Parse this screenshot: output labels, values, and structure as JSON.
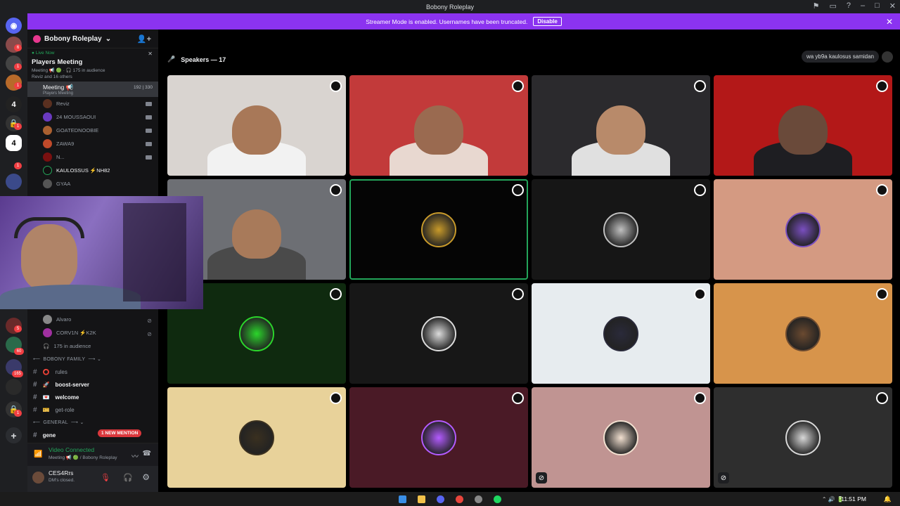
{
  "window": {
    "title": "Bobony Roleplay"
  },
  "banner": {
    "text": "Streamer Mode is enabled. Usernames have been truncated.",
    "button": "Disable"
  },
  "server": {
    "name": "Bobony Roleplay"
  },
  "event": {
    "live": "Live Now",
    "title": "Players Meeting",
    "meta": "Meeting 📢 🟢 · 🎧 175 in audience",
    "people": "Reviz and 16 others"
  },
  "stage_channel": {
    "name": "Meeting",
    "emoji": "📢",
    "sub": "Players Meeting",
    "count_a": "192",
    "count_b": "330"
  },
  "voice_users": [
    "Reviz",
    "24 MOUSSAOUI",
    "GOATEDNOOBIE",
    "ZAWA9",
    "N...",
    "KAULOSSUS ⚡NH82",
    "GYAA"
  ],
  "lower_users": [
    "Alvaro",
    "CORV1N ⚡K2K"
  ],
  "audience": "175 in audience",
  "categories": [
    "BOBONY FAMILY",
    "GENERAL"
  ],
  "text_channels": [
    {
      "name": "rules",
      "bold": false
    },
    {
      "name": "boost-server",
      "bold": true
    },
    {
      "name": "welcome",
      "bold": true
    },
    {
      "name": "get-role",
      "bold": false
    }
  ],
  "general_partial": "gene",
  "mention_pill": "1 NEW MENTION",
  "voice_connected": {
    "status": "Video Connected",
    "detail": "Meeting 📢 🟢 / Bobony Roleplay"
  },
  "user": {
    "name": "CES4Rrs",
    "status": "DM's closed."
  },
  "stage": {
    "header": "Speakers — 17",
    "topic_pill": "wa yb9a kaulosus samidan"
  },
  "rail_badges": [
    "6",
    "1",
    "1",
    "1",
    "1",
    "5",
    "60",
    "165",
    "1"
  ],
  "tiles": [
    {
      "type": "cam",
      "bg": "#d9d4d0"
    },
    {
      "type": "cam",
      "bg": "#c23a3a"
    },
    {
      "type": "cam",
      "bg": "#2b2a2d"
    },
    {
      "type": "cam",
      "bg": "#b31818"
    },
    {
      "type": "cam",
      "bg": "#6d6f74"
    },
    {
      "type": "avatar",
      "bg": "#050505",
      "ring": "#c89a2a",
      "speaking": true
    },
    {
      "type": "avatar",
      "bg": "#161616",
      "ring": "#c0c0c0"
    },
    {
      "type": "avatar",
      "bg": "#d49a82",
      "ring": "#7a4fc0"
    },
    {
      "type": "avatar",
      "bg": "#0f2a0f",
      "ring": "#2bd62b"
    },
    {
      "type": "avatar",
      "bg": "#171717",
      "ring": "#dcdcdc"
    },
    {
      "type": "avatar",
      "bg": "#e7ecef",
      "ring": "#2a2a3a"
    },
    {
      "type": "avatar",
      "bg": "#d7944b",
      "ring": "#6b4a30"
    },
    {
      "type": "avatar",
      "bg": "#e8d29a",
      "ring": "#3a3020"
    },
    {
      "type": "avatar",
      "bg": "#4a1a26",
      "ring": "#b35bff"
    },
    {
      "type": "avatar",
      "bg": "#c09492",
      "ring": "#f2e0d0",
      "muted": true
    },
    {
      "type": "avatar",
      "bg": "#2e2e2e",
      "ring": "#d8d8d8",
      "muted": true
    }
  ],
  "taskbar": {
    "time": "11:51 PM"
  }
}
